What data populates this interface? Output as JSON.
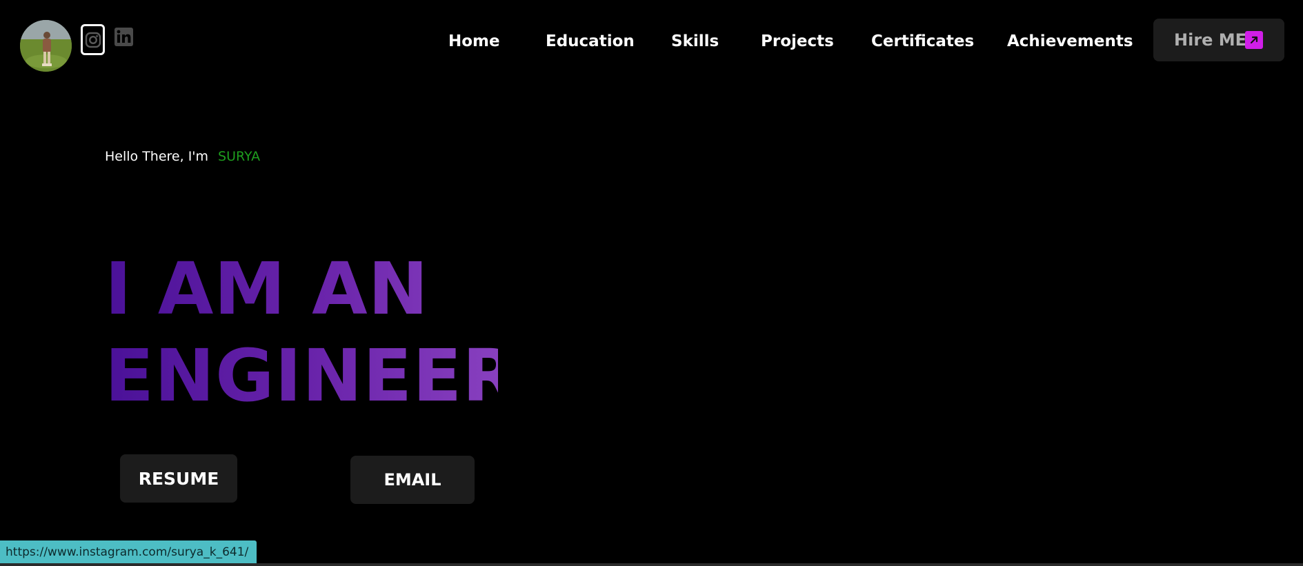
{
  "header": {
    "social": {
      "instagram_icon": "instagram-icon",
      "linkedin_icon": "linkedin-icon"
    },
    "nav": {
      "items": [
        {
          "label": "Home"
        },
        {
          "label": "Education"
        },
        {
          "label": "Skills"
        },
        {
          "label": "Projects"
        },
        {
          "label": "Certificates"
        },
        {
          "label": "Achievements"
        }
      ]
    },
    "hire_button": {
      "label": "Hire ME",
      "icon": "arrow-up-right-icon",
      "icon_color": "#d01ee8"
    }
  },
  "hero": {
    "greeting": "Hello There, I'm",
    "name": "SURYA",
    "name_color": "#1e9e1e",
    "headline_line1": "I AM AN",
    "headline_line2": "ENGINEER",
    "headline_color": "#6a24ab",
    "resume_label": "RESUME",
    "email_label": "EMAIL"
  },
  "statusbar": {
    "url": "https://www.instagram.com/surya_k_641/"
  }
}
